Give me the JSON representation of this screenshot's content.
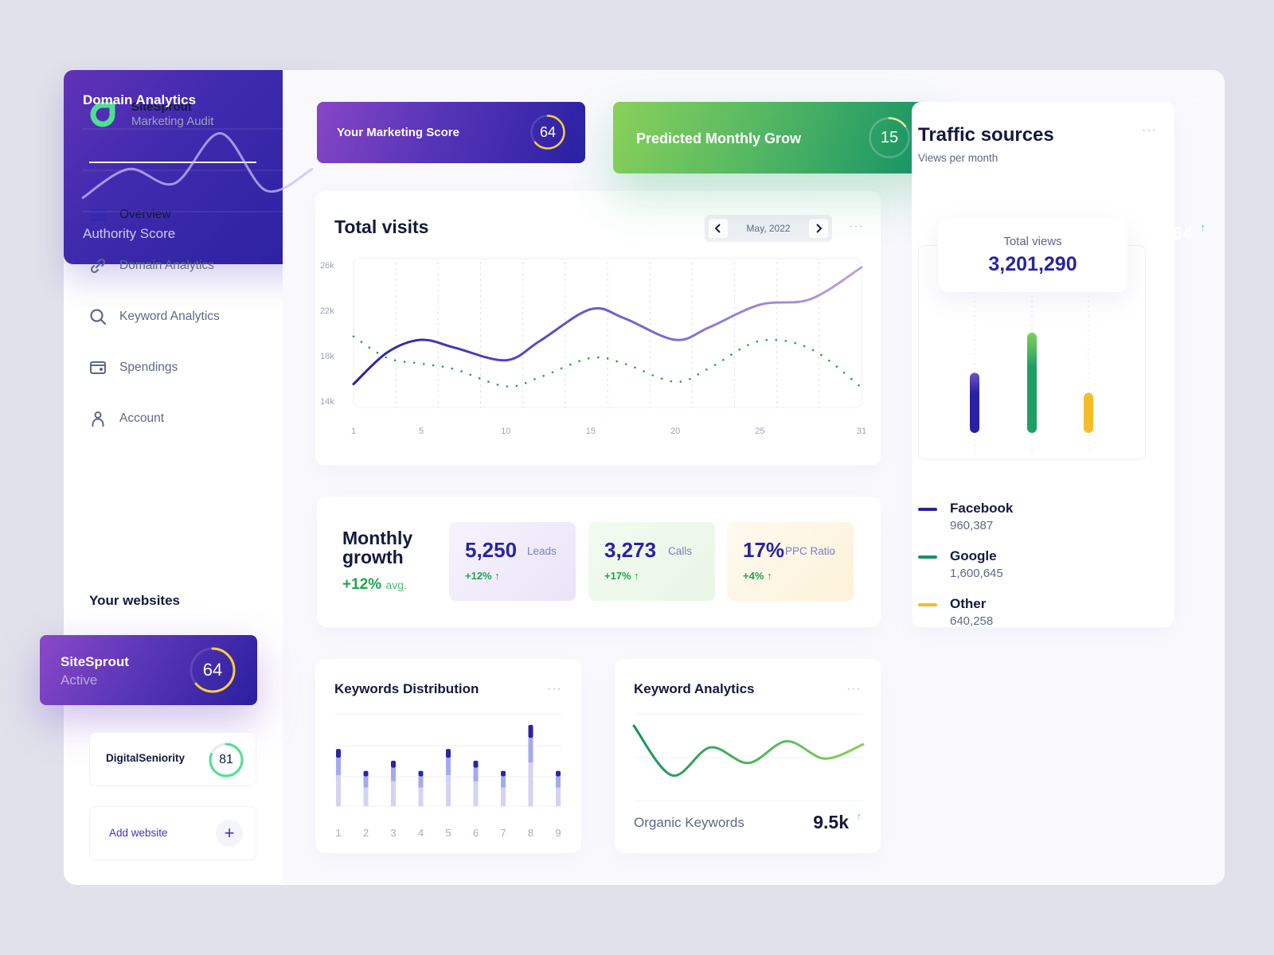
{
  "brand": {
    "name": "SiteSprout",
    "subtitle": "Marketing Audit",
    "logo_icon": "leaf-drop-icon",
    "color": "#4de08f"
  },
  "sidebar": {
    "items": [
      {
        "label": "Overview",
        "icon": "menu-icon",
        "active": true
      },
      {
        "label": "Domain Analytics",
        "icon": "link-icon",
        "active": false
      },
      {
        "label": "Keyword Analytics",
        "icon": "search-icon",
        "active": false
      },
      {
        "label": "Spendings",
        "icon": "wallet-icon",
        "active": false
      },
      {
        "label": "Account",
        "icon": "user-icon",
        "active": false
      }
    ],
    "websites_title": "Your websites",
    "websites": [
      {
        "name": "SiteSprout",
        "status": "Active",
        "score": "64",
        "score_value": 64
      },
      {
        "name": "DigitalSeniority",
        "score": "81",
        "score_value": 81
      }
    ],
    "add_website_label": "Add website",
    "add_icon": "+"
  },
  "score_cards": {
    "marketing": {
      "title": "Your Marketing Score",
      "score": "64",
      "score_value": 64
    },
    "growth": {
      "title": "Predicted Monthly Grow",
      "score": "15",
      "score_value": 15
    }
  },
  "total_visits": {
    "title": "Total visits",
    "date": "May, 2022",
    "prev_icon": "‹",
    "next_icon": "›",
    "menu": "···"
  },
  "traffic": {
    "title": "Traffic sources",
    "subtitle": "Views per month",
    "menu": "···",
    "total_label": "Total views",
    "total_value": "3,201,290",
    "sources": [
      {
        "name": "Facebook",
        "value": "960,387",
        "color": "#2a23a0"
      },
      {
        "name": "Google",
        "value": "1,600,645",
        "color": "#169268"
      },
      {
        "name": "Other",
        "value": "640,258",
        "color": "#f6bd2a"
      }
    ]
  },
  "monthly_growth": {
    "title": "Monthly growth",
    "avg_value": "+12%",
    "avg_label": "avg.",
    "metrics": [
      {
        "value": "5,250",
        "label": "Leads",
        "change": "+12%"
      },
      {
        "value": "3,273",
        "label": "Calls",
        "change": "+17%"
      },
      {
        "value": "17%",
        "label": "PPC Ratio",
        "change": "+4%"
      }
    ],
    "up_icon": "↑"
  },
  "keywords_distribution": {
    "title": "Keywords Distribution",
    "menu": "···"
  },
  "keyword_analytics": {
    "title": "Keyword Analytics",
    "menu": "···",
    "stat_label": "Organic Keywords",
    "stat_value": "9.5k",
    "up_icon": "↑"
  },
  "domain_analytics": {
    "title": "Domain Analytics",
    "menu": "···",
    "stat_label": "Authority Score",
    "stat_value": "64",
    "up_icon": "↑"
  },
  "chart_data": [
    {
      "type": "line",
      "title": "Total visits",
      "x": [
        1,
        3,
        5,
        7,
        10,
        12,
        15,
        17,
        20,
        22,
        25,
        28,
        31
      ],
      "xticks": [
        "1",
        "5",
        "10",
        "15",
        "20",
        "25",
        "31"
      ],
      "xtick_values": [
        1,
        5,
        10,
        15,
        20,
        25,
        31
      ],
      "yticks": [
        "26k",
        "22k",
        "18k",
        "14k"
      ],
      "ytick_values": [
        26000,
        22000,
        18000,
        14000
      ],
      "ylim": [
        14000,
        26000
      ],
      "xlim": [
        1,
        31
      ],
      "series": [
        {
          "name": "visits",
          "style": "solid",
          "values": [
            15500,
            18300,
            19400,
            18700,
            17600,
            19300,
            22100,
            21300,
            19400,
            20500,
            22500,
            23000,
            25800
          ]
        },
        {
          "name": "comparison",
          "style": "dotted",
          "values": [
            19700,
            17800,
            17300,
            16800,
            15300,
            16100,
            17800,
            17300,
            15700,
            16900,
            19300,
            18600,
            15200
          ]
        }
      ]
    },
    {
      "type": "bar",
      "title": "Traffic sources",
      "categories": [
        "Facebook",
        "Google",
        "Other"
      ],
      "values": [
        960387,
        1600645,
        640258
      ],
      "colors": [
        "#2a23a0",
        "#169268",
        "#f6bd2a"
      ]
    },
    {
      "type": "bar",
      "title": "Keywords Distribution",
      "categories": [
        "1",
        "2",
        "3",
        "4",
        "5",
        "6",
        "7",
        "8",
        "9"
      ],
      "stacked": true,
      "ylim": [
        0,
        4
      ],
      "series": [
        {
          "name": "base",
          "color": "#d5d3f1",
          "values": [
            1.25,
            0.75,
            1.0,
            0.75,
            1.25,
            1.0,
            0.75,
            1.75,
            0.75
          ]
        },
        {
          "name": "middle",
          "color": "#a5a9ee",
          "values": [
            0.7,
            0.45,
            0.55,
            0.45,
            0.7,
            0.55,
            0.45,
            1.0,
            0.45
          ]
        },
        {
          "name": "top",
          "color": "#2e23a6",
          "values": [
            0.35,
            0.22,
            0.28,
            0.22,
            0.35,
            0.28,
            0.22,
            0.52,
            0.22
          ]
        }
      ]
    },
    {
      "type": "line",
      "title": "Keyword Analytics",
      "values": [
        0.95,
        0.15,
        0.6,
        0.35,
        0.7,
        0.42,
        0.65
      ]
    },
    {
      "type": "line",
      "title": "Domain Analytics",
      "values": [
        0.05,
        0.45,
        0.25,
        0.95,
        0.15,
        0.45
      ]
    }
  ]
}
